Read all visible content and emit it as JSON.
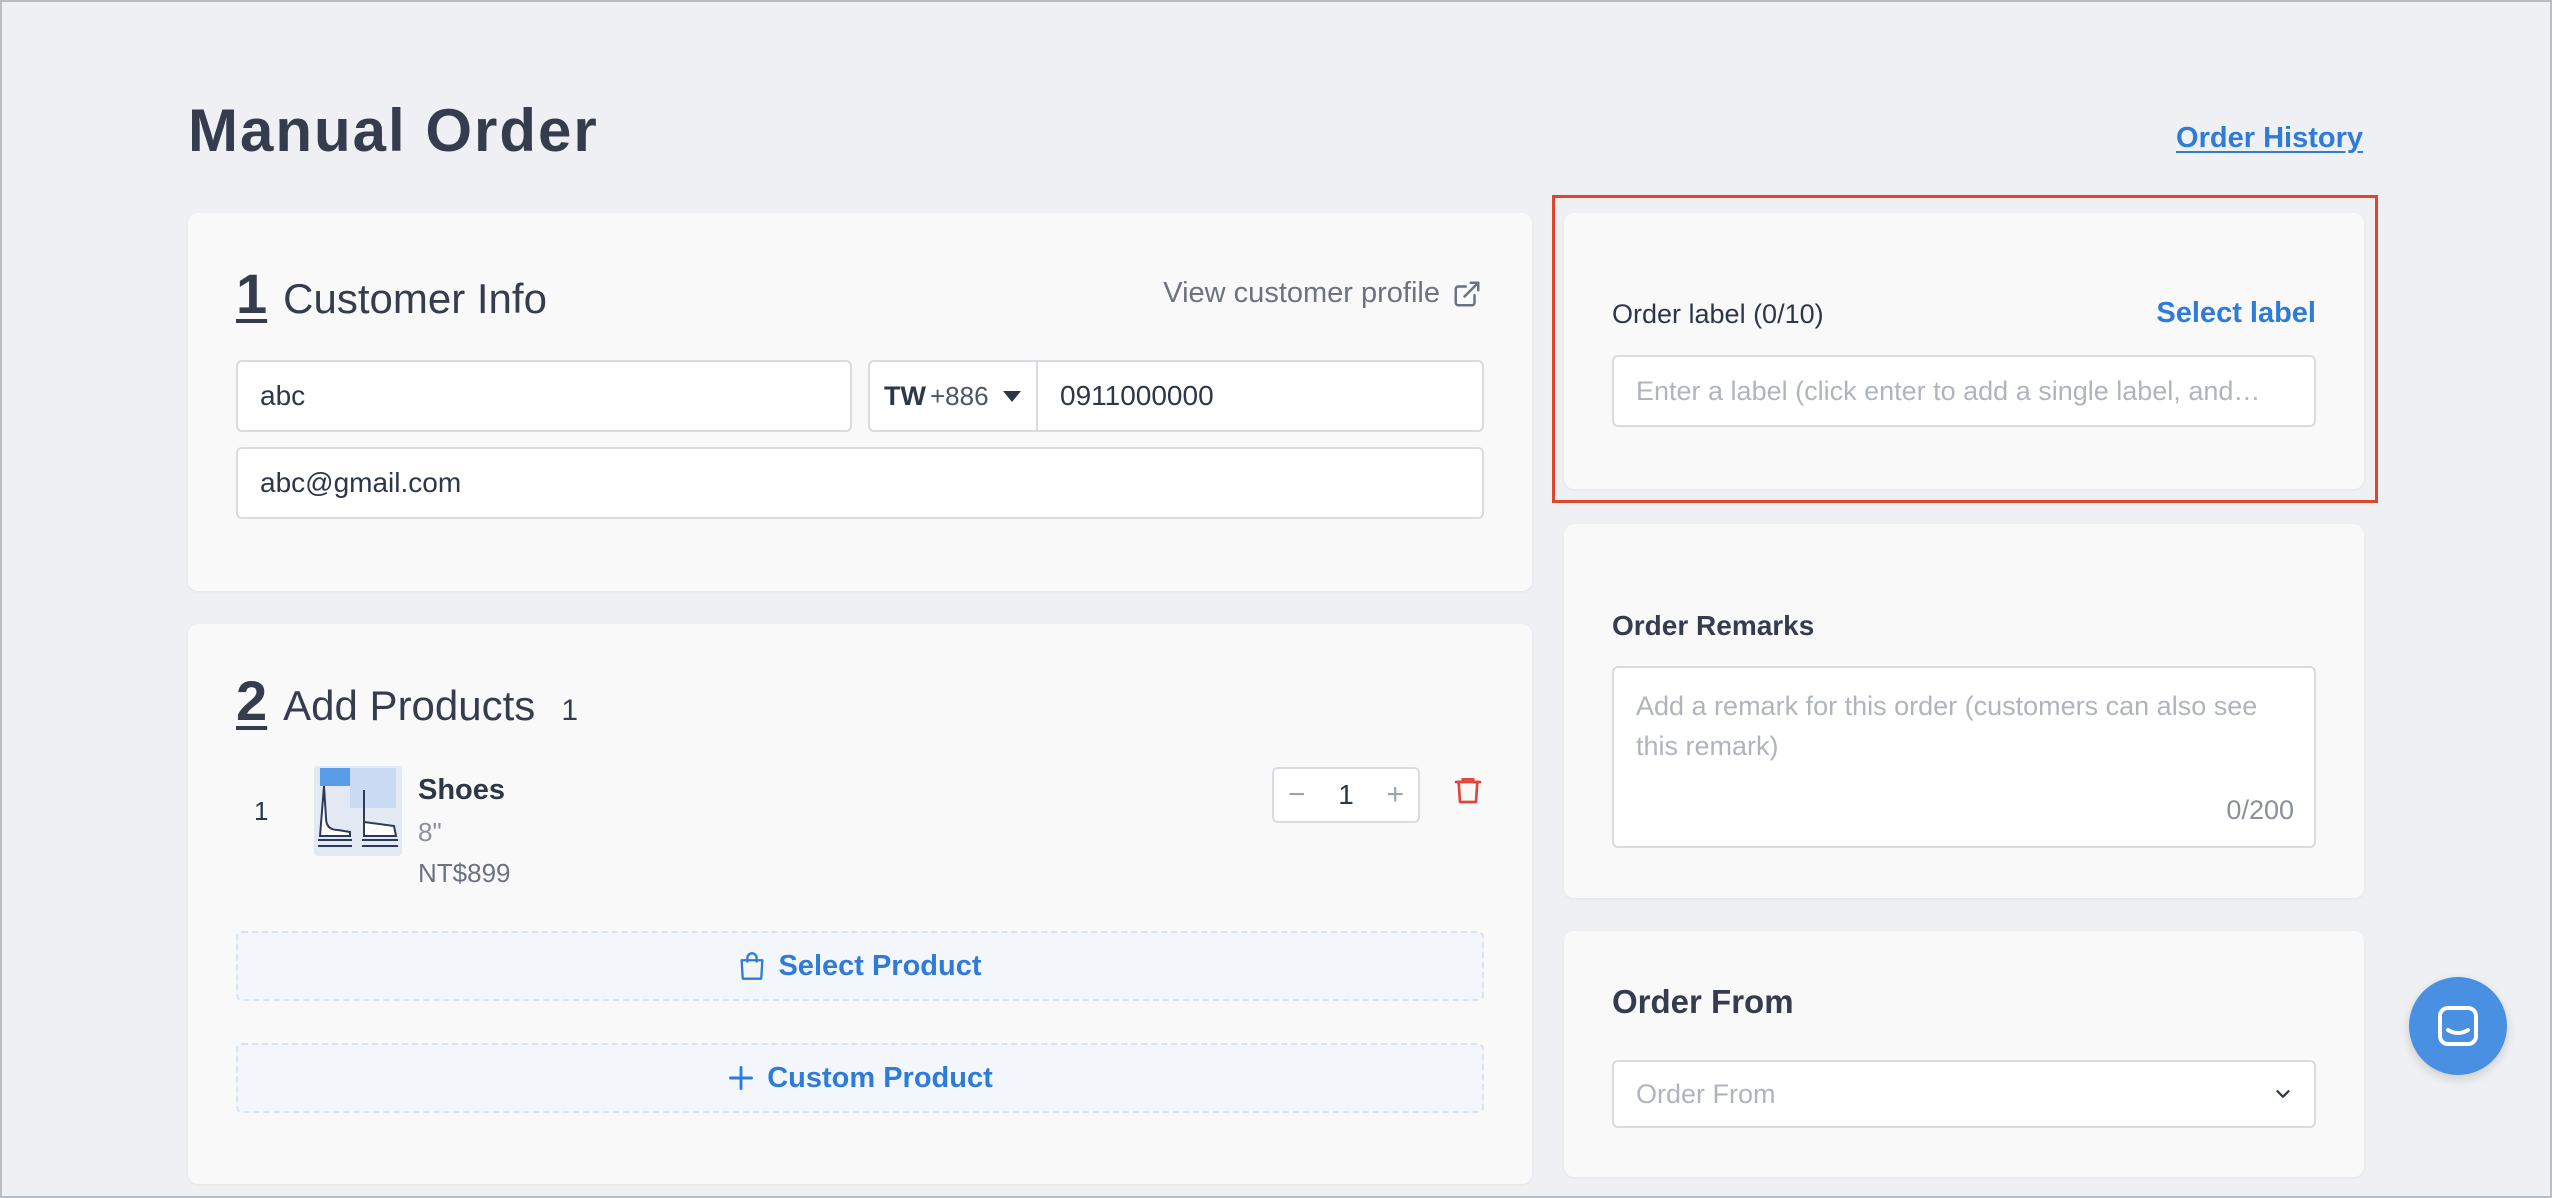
{
  "page": {
    "title": "Manual Order",
    "order_history_label": "Order History"
  },
  "customer": {
    "section_number": "1",
    "section_title": "Customer Info",
    "view_profile_label": "View customer profile",
    "name_value": "abc",
    "country_code": "TW",
    "dial_code": "+886",
    "phone_value": "0911000000",
    "email_value": "abc@gmail.com"
  },
  "products": {
    "section_number": "2",
    "section_title": "Add Products",
    "count": "1",
    "items": [
      {
        "index": "1",
        "name": "Shoes",
        "variant": "8\"",
        "price": "NT$899",
        "quantity": "1"
      }
    ],
    "select_product_label": "Select Product",
    "custom_product_label": "Custom Product"
  },
  "order_label": {
    "title": "Order label (0/10)",
    "select_label": "Select label",
    "placeholder": "Enter a label (click enter to add a single label, and…"
  },
  "remarks": {
    "title": "Order Remarks",
    "placeholder": "Add a remark for this order (customers can also see this remark)",
    "count": "0/200"
  },
  "order_from": {
    "title": "Order From",
    "placeholder": "Order From"
  },
  "colors": {
    "accent": "#2f7bd9",
    "highlight": "#e0462c",
    "danger": "#e0463a",
    "chat": "#4a90e2"
  },
  "icons": {
    "external_link": "external-link-icon",
    "trash": "trash-icon",
    "bag": "shopping-bag-icon",
    "plus": "plus-icon",
    "chevron": "chevron-down-icon",
    "chat": "chat-icon"
  }
}
